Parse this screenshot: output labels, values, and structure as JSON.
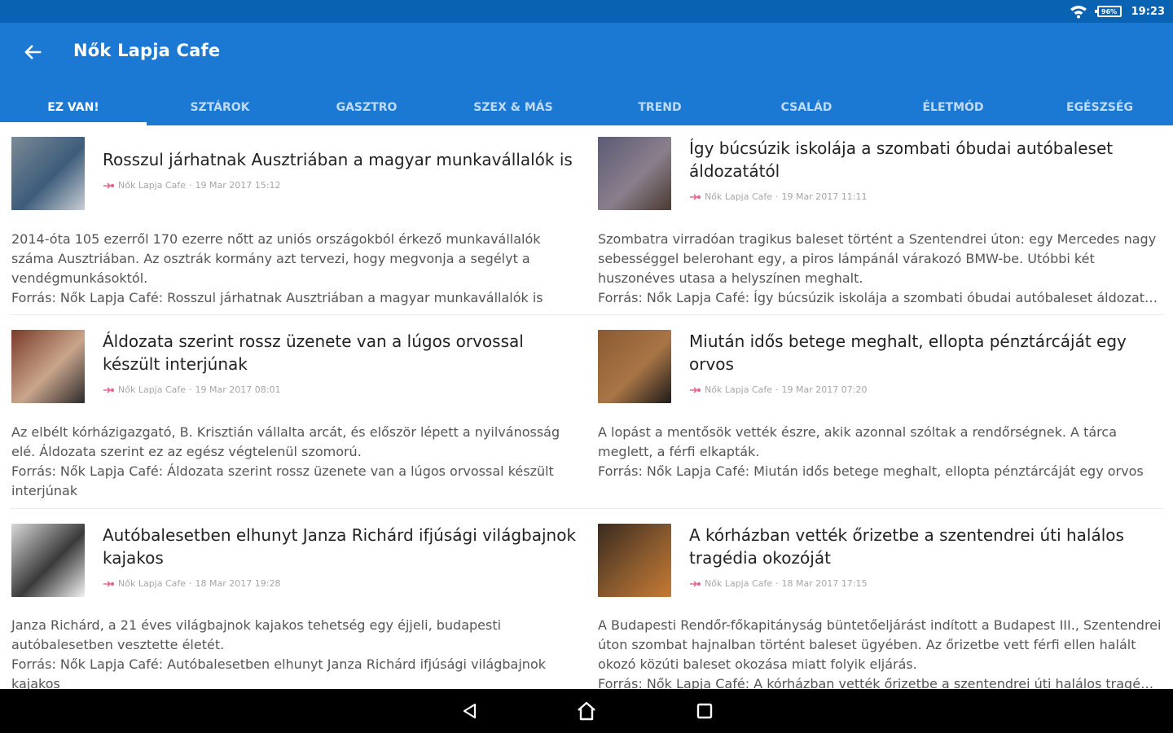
{
  "status_bar": {
    "battery": "96%",
    "time": "19:23"
  },
  "app_bar": {
    "title": "Nők Lapja Cafe"
  },
  "tabs": [
    "EZ VAN!",
    "SZTÁROK",
    "GASZTRO",
    "SZEX & MÁS",
    "TREND",
    "CSALÁD",
    "ÉLETMÓD",
    "EGÉSZSÉG"
  ],
  "articles": [
    {
      "title": "Rosszul járhatnak Ausztriában a magyar munkavállalók is",
      "source": "Nők Lapja Cafe",
      "date": "19 Mar 2017 15:12",
      "body": "2014-óta 105 ezerről 170 ezerre nőtt az uniós országokból érkező munkavállalók száma Ausztriában. Az osztrák kormány azt tervezi, hogy megvonja a segélyt a vendégmunkásoktól.",
      "source_line": "Forrás: Nők Lapja Café: Rosszul járhatnak Ausztriában a magyar munkavállalók is",
      "thumb_colors": [
        "#7b8a96",
        "#3d5c7a",
        "#c9ced4"
      ]
    },
    {
      "title": "Így búcsúzik iskolája a szombati óbudai autóbaleset áldozatától",
      "source": "Nők Lapja Cafe",
      "date": "19 Mar 2017 11:11",
      "body": "Szombatra virradóan tragikus baleset történt a Szentendrei úton: egy Mercedes nagy sebességgel belerohant egy, a piros lámpánál várakozó BMW-be. Utóbbi két huszonéves utasa a helyszínen meghalt.",
      "source_line": "Forrás: Nők Lapja Café: Így búcsúzik iskolája a szombati óbudai autóbaleset áldozatától",
      "thumb_colors": [
        "#5b5a75",
        "#8a7f8c",
        "#4a3a30"
      ]
    },
    {
      "title": "Áldozata szerint rossz üzenete van a lúgos orvossal készült interjúnak",
      "source": "Nők Lapja Cafe",
      "date": "19 Mar 2017 08:01",
      "body": "Az elbélt kórházigazgató, B. Krisztián vállalta arcát, és először lépett a nyilvánosság elé. Áldozata szerint ez az egész végtelenül szomorú.",
      "source_line": "Forrás: Nők Lapja Café: Áldozata szerint rossz üzenete van a lúgos orvossal készült interjúnak",
      "thumb_colors": [
        "#7a3b2a",
        "#c9a58c",
        "#2d2a2a"
      ]
    },
    {
      "title": "Miután idős betege meghalt, ellopta pénztárcáját egy orvos",
      "source": "Nők Lapja Cafe",
      "date": "19 Mar 2017 07:20",
      "body": "A lopást a mentősök vették észre, akik azonnal szóltak a rendőrségnek. A tárca meglett, a férfi elkapták.",
      "source_line": "Forrás: Nők Lapja Café: Miután idős betege meghalt, ellopta pénztárcáját egy orvos",
      "thumb_colors": [
        "#8a5a32",
        "#a97546",
        "#1e1b1a"
      ]
    },
    {
      "title": "Autóbalesetben elhunyt Janza Richárd ifjúsági világbajnok kajakos",
      "source": "Nők Lapja Cafe",
      "date": "18 Mar 2017 19:28",
      "body": "Janza Richárd, a 21 éves világbajnok kajakos tehetség egy éjjeli, budapesti autóbalesetben vesztette életét.",
      "source_line": "Forrás: Nők Lapja Café: Autóbalesetben elhunyt Janza Richárd ifjúsági világbajnok kajakos",
      "thumb_colors": [
        "#d8d8d8",
        "#3a3a3a",
        "#f2f2f2"
      ]
    },
    {
      "title": "A kórházban vették őrizetbe a szentendrei úti halálos tragédia okozóját",
      "source": "Nők Lapja Cafe",
      "date": "18 Mar 2017 17:15",
      "body": "A Budapesti Rendőr-főkapitányság büntetőeljárást indított a Budapest III., Szentendrei úton szombat hajnalban történt baleset ügyében. Az őrizetbe vett férfi ellen halált okozó közúti baleset okozása miatt folyik eljárás.",
      "source_line": "Forrás: Nők Lapja Café: A kórházban vették őrizetbe a szentendrei úti halálos tragédia okozóját",
      "thumb_colors": [
        "#3a2a1f",
        "#8a5a2e",
        "#c77a34"
      ]
    }
  ],
  "colors": {
    "status_bar": "#0a62b3",
    "app_bar": "#1c79d3",
    "nav_bar": "#000000"
  },
  "nav": {
    "icons": [
      "back-icon",
      "home-icon",
      "recents-icon"
    ]
  }
}
